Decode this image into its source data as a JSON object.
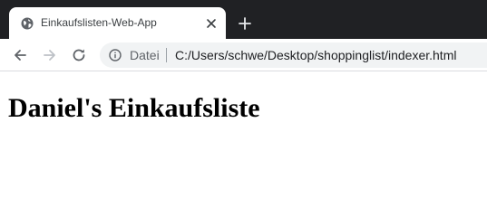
{
  "browser": {
    "tab": {
      "title": "Einkaufslisten-Web-App",
      "favicon": "globe-icon",
      "close_icon": "close-icon"
    },
    "new_tab_icon": "plus-icon",
    "toolbar": {
      "back_icon": "arrow-left-icon",
      "forward_icon": "arrow-right-icon",
      "reload_icon": "reload-icon"
    },
    "omnibox": {
      "info_icon": "info-icon",
      "scheme_label": "Datei",
      "url": "C:/Users/schwe/Desktop/shoppinglist/indexer.html"
    },
    "colors": {
      "tabstrip": "#202124",
      "tab_active": "#ffffff",
      "omnibox": "#f1f3f4"
    }
  },
  "page": {
    "heading": "Daniel's Einkaufsliste"
  }
}
